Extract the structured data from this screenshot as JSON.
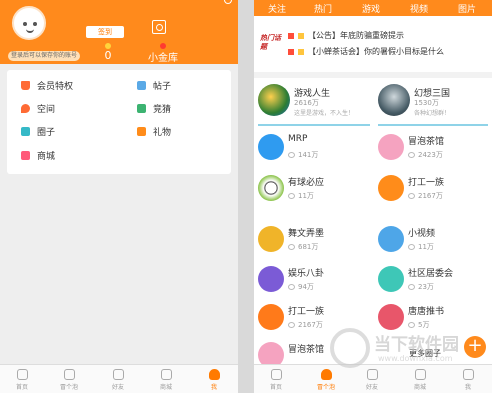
{
  "left": {
    "login_hint": "登录后可以保存你的账号",
    "signin_label": "签到",
    "coin_value": "0",
    "vault_label": "小金库",
    "menu": [
      {
        "label": "会员特权",
        "icon": "crown-icon",
        "color": "#ff6b35"
      },
      {
        "label": "帖子",
        "icon": "document-icon",
        "color": "#5aa9e6"
      },
      {
        "label": "空间",
        "icon": "location-icon",
        "color": "#ff6b35"
      },
      {
        "label": "竞猜",
        "icon": "trophy-icon",
        "color": "#3cb371"
      },
      {
        "label": "圈子",
        "icon": "user-circle-icon",
        "color": "#35b9c7"
      },
      {
        "label": "礼物",
        "icon": "gift-icon",
        "color": "#ff8c1a"
      },
      {
        "label": "商城",
        "icon": "store-icon",
        "color": "#ff5a7a"
      }
    ],
    "tabbar": [
      "首页",
      "冒个泡",
      "好友",
      "商城",
      "我"
    ]
  },
  "right": {
    "tabs": [
      "关注",
      "热门",
      "游戏",
      "视频",
      "图片"
    ],
    "hot_logo": "热门话题",
    "news": [
      "【公告】年底防骗重磅提示",
      "【小蝉茶话会】你的暑假小目标是什么"
    ],
    "featured": [
      {
        "name": "游戏人生",
        "count": "2616万",
        "sub": "这里是游戏，不入生！"
      },
      {
        "name": "幻想三国",
        "count": "1530万",
        "sub": "各种幻想群！"
      }
    ],
    "rows": [
      {
        "name": "MRP",
        "count": "141万"
      },
      {
        "name": "冒泡茶馆",
        "count": "2423万"
      },
      {
        "name": "有球必应",
        "count": "11万"
      },
      {
        "name": "打工一族",
        "count": "2167万"
      },
      {
        "name": "舞文弄墨",
        "count": "681万"
      },
      {
        "name": "小视频",
        "count": "11万"
      },
      {
        "name": "娱乐八卦",
        "count": "94万"
      },
      {
        "name": "社区居委会",
        "count": "23万"
      },
      {
        "name": "打工一族",
        "count": "2167万"
      },
      {
        "name": "唐唐推书",
        "count": "5万"
      },
      {
        "name": "冒泡茶馆",
        "count": ""
      }
    ],
    "more_label": "更多圈子",
    "plus_label": "+",
    "tabbar": [
      "首页",
      "冒个泡",
      "好友",
      "商城",
      "我"
    ]
  },
  "watermark": {
    "text": "当下软件园",
    "url": "www.downxia.com"
  }
}
